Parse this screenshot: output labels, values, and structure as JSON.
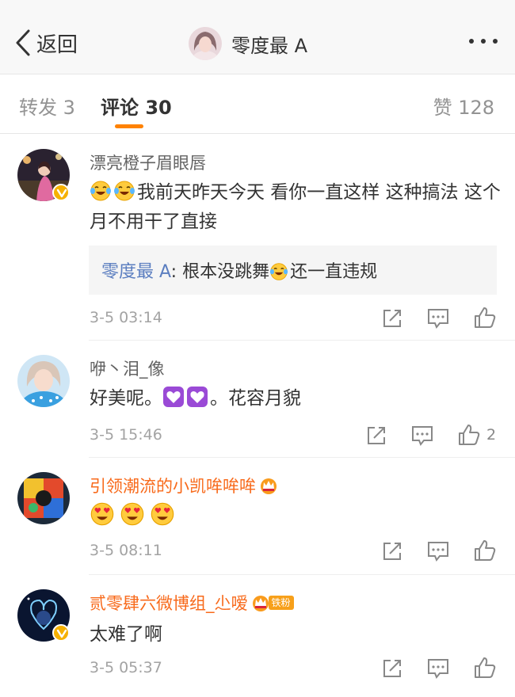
{
  "nav": {
    "back_label": "返回",
    "title": "零度最 A"
  },
  "tabs": {
    "repost": "转发 3",
    "comment": "评论 30",
    "like": "赞 128"
  },
  "colors": {
    "accent": "#ff8200",
    "vip_name": "#f86a1b",
    "reply_name": "#5b7ec0",
    "verified_badge": "#f6b100"
  },
  "comments": [
    {
      "username": "漂亮橙子眉眼唇",
      "verified": true,
      "emoji_prefix": [
        "crying-laughing-emoji",
        "crying-laughing-emoji"
      ],
      "text": "我前天昨天今天 看你一直这样 这种搞法 这个月不用干了直接",
      "reply": {
        "author": "零度最 A",
        "text_before": ": 根本没跳舞",
        "emoji": "crying-laughing-emoji",
        "text_after": "还一直违规"
      },
      "time": "3-5 03:14",
      "likes": ""
    },
    {
      "username": "咿丶泪_像",
      "verified": false,
      "text_before": "好美呢。",
      "emoji": [
        "purple-heart-emoji",
        "purple-heart-emoji"
      ],
      "text_after": "。花容月貌",
      "time": "3-5 15:46",
      "likes": "2"
    },
    {
      "username": "引领潮流的小凯哞哞哞",
      "verified": false,
      "badge": "vip-crown-icon",
      "emoji": [
        "heart-eyes-emoji",
        "heart-eyes-emoji",
        "heart-eyes-emoji"
      ],
      "time": "3-5 08:11",
      "likes": ""
    },
    {
      "username": "贰零肆六微博组_尐嗳",
      "verified": true,
      "badge": "vip-crown-icon",
      "fan_badge": "铁粉",
      "text": "太难了啊",
      "time": "3-5 05:37",
      "likes": ""
    }
  ]
}
